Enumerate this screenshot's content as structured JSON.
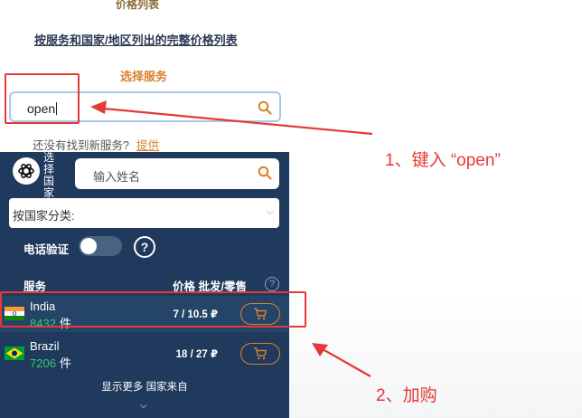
{
  "top_cut_text": "价格列表",
  "full_list_link": "按服务和国家/地区列出的完整价格列表",
  "select_service_label": "选择服务",
  "search": {
    "value": "open"
  },
  "not_found": {
    "text": "还没有找到新服务?",
    "suggest": "提供"
  },
  "country_panel": {
    "vertical_label": "选择国家",
    "name_input_placeholder": "输入姓名",
    "sort_label": "按国家分类:",
    "phone_verify_label": "电话验证",
    "help_glyph": "?",
    "header_service": "服务",
    "header_price": "价格 批发/零售",
    "header_help_glyph": "?",
    "rows": [
      {
        "country": "India",
        "count": "8432",
        "unit": "件",
        "price": "7 / 10.5 ₽"
      },
      {
        "country": "Brazil",
        "count": "7206",
        "unit": "件",
        "price": "18 / 27 ₽"
      }
    ],
    "show_more": "显示更多 国家来自",
    "icons": {
      "search": "search-icon",
      "logo": "openai-logo-icon",
      "cart": "cart-icon",
      "chevron": "chevron-down-icon"
    }
  },
  "annotations": {
    "step1": "1、键入 “open”",
    "step2": "2、加购",
    "color": "#e53935"
  },
  "colors": {
    "accent": "#d9822b",
    "panel": "#1f3a5c",
    "count_green": "#2ecc71"
  }
}
